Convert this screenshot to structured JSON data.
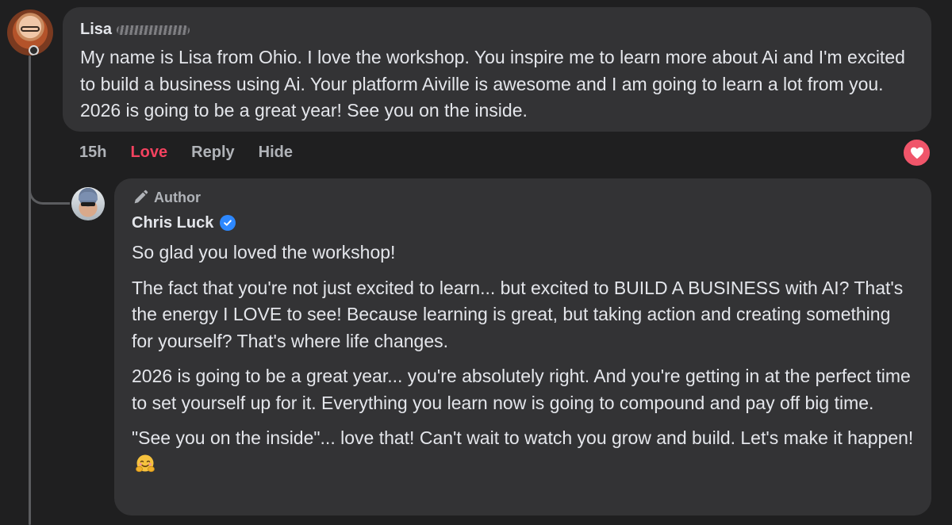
{
  "comment": {
    "author_name": "Lisa",
    "text": "My name is Lisa from Ohio. I love the workshop. You inspire me to learn more about Ai and I'm excited to build a business using Ai. Your platform Aiville is awesome and I am going to learn a lot from you. 2026 is going to be a great year! See you on the inside.",
    "actions": {
      "time": "15h",
      "love": "Love",
      "reply": "Reply",
      "hide": "Hide"
    },
    "reaction_icon": "heart-icon"
  },
  "reply": {
    "badge": "Author",
    "author_name": "Chris Luck",
    "verified": true,
    "paragraphs": [
      "So glad you loved the workshop!",
      "The fact that you're not just excited to learn... but excited to BUILD A BUSINESS with AI? That's the energy I LOVE to see! Because learning is great, but taking action and creating something for yourself? That's where life changes.",
      "2026 is going to be a great year... you're absolutely right. And you're getting in at the perfect time to set yourself up for it. Everything you learn now is going to compound and pay off big time.",
      "\"See you on the inside\"... love that! Can't wait to watch you grow and build. Let's make it happen!"
    ],
    "emoji": "hugging-face-emoji"
  },
  "colors": {
    "background": "#1f1f20",
    "bubble": "#333335",
    "text": "#e4e6eb",
    "muted": "#b0b3b8",
    "love": "#f3425f",
    "verified": "#2d88ff"
  }
}
